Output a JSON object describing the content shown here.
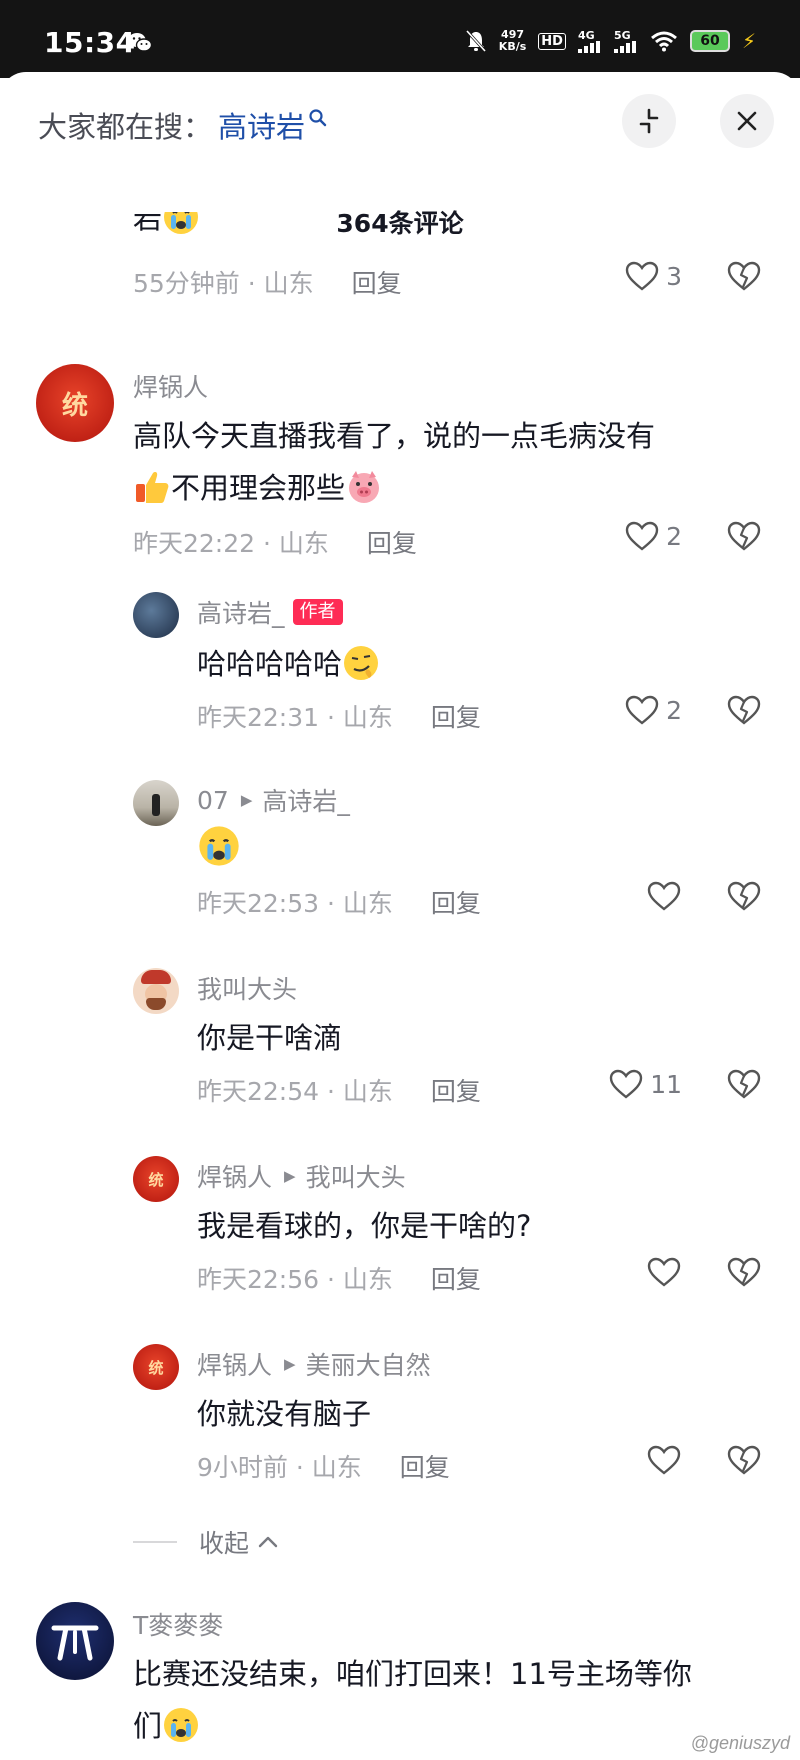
{
  "status_bar": {
    "time": "15:34",
    "speed_value": "497",
    "speed_unit": "KB/s",
    "hd_label": "HD",
    "net_4g": "4G",
    "net_5g": "5G",
    "battery": "60"
  },
  "search": {
    "lead": "大家都在搜：",
    "term": "高诗岩"
  },
  "header": {
    "title": "364条评论"
  },
  "comments": [
    {
      "text": "岩",
      "time": "55分钟前 · 山东",
      "reply": "回复",
      "likes": "3"
    },
    {
      "author": "焊锅人",
      "text_line1": "高队今天直播我看了，说的一点毛病没有",
      "text_line2": "不用理会那些",
      "time": "昨天22:22 · 山东",
      "reply": "回复",
      "likes": "2"
    },
    {
      "author": "高诗岩_",
      "badge": "作者",
      "text": "哈哈哈哈哈",
      "time": "昨天22:31 · 山东",
      "reply": "回复",
      "likes": "2"
    },
    {
      "author": "07",
      "reply_to": "高诗岩_",
      "time": "昨天22:53 · 山东",
      "reply": "回复",
      "likes": null
    },
    {
      "author": "我叫大头",
      "text": "你是干啥滴",
      "time": "昨天22:54 · 山东",
      "reply": "回复",
      "likes": "11"
    },
    {
      "author": "焊锅人",
      "reply_to": "我叫大头",
      "text": "我是看球的，你是干啥的?",
      "time": "昨天22:56 · 山东",
      "reply": "回复",
      "likes": null
    },
    {
      "author": "焊锅人",
      "reply_to": "美丽大自然",
      "text": "你就没有脑子",
      "time": "9小时前 · 山东",
      "reply": "回复",
      "likes": null
    },
    {
      "author": "T麥麥麥",
      "text_line1": "比赛还没结束，咱们打回来！11号主场等你",
      "text_line2": "们"
    }
  ],
  "collapse": {
    "label": "收起"
  },
  "avatar_text": {
    "tong": "统"
  },
  "watermark": "@geniuszyd",
  "colors": {
    "accent_link": "#1f4fa8",
    "author_badge": "#fe2c55",
    "text": "#161823",
    "meta": "#a6a7ac"
  }
}
